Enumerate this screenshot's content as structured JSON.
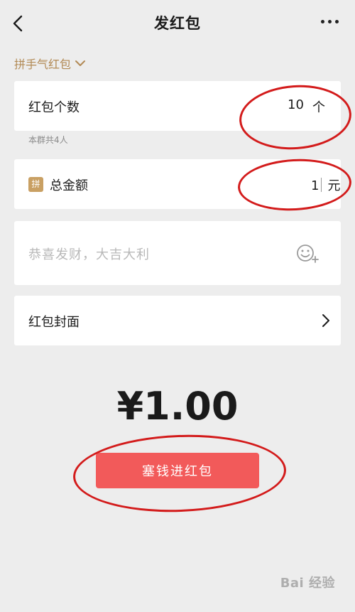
{
  "header": {
    "title": "发红包",
    "back_icon": "chevron-left-icon",
    "more_icon": "more-dots-icon"
  },
  "packet_type": {
    "label": "拼手气红包",
    "icon": "chevron-down-icon"
  },
  "count_field": {
    "label": "红包个数",
    "value": "10",
    "unit": "个",
    "hint": "本群共4人"
  },
  "amount_field": {
    "badge": "拼",
    "label": "总金额",
    "value": "1",
    "unit": "元"
  },
  "greeting_field": {
    "placeholder": "恭喜发财，大吉大利",
    "icon": "emoji-add-icon"
  },
  "cover_row": {
    "label": "红包封面",
    "icon": "chevron-right-icon"
  },
  "total": {
    "display": "¥1.00"
  },
  "submit_button": {
    "label": "塞钱进红包"
  },
  "watermark": {
    "text": "Bai 经验"
  },
  "colors": {
    "accent": "#f25a5a",
    "gold": "#b28a55",
    "annotation": "#d31b1b"
  }
}
